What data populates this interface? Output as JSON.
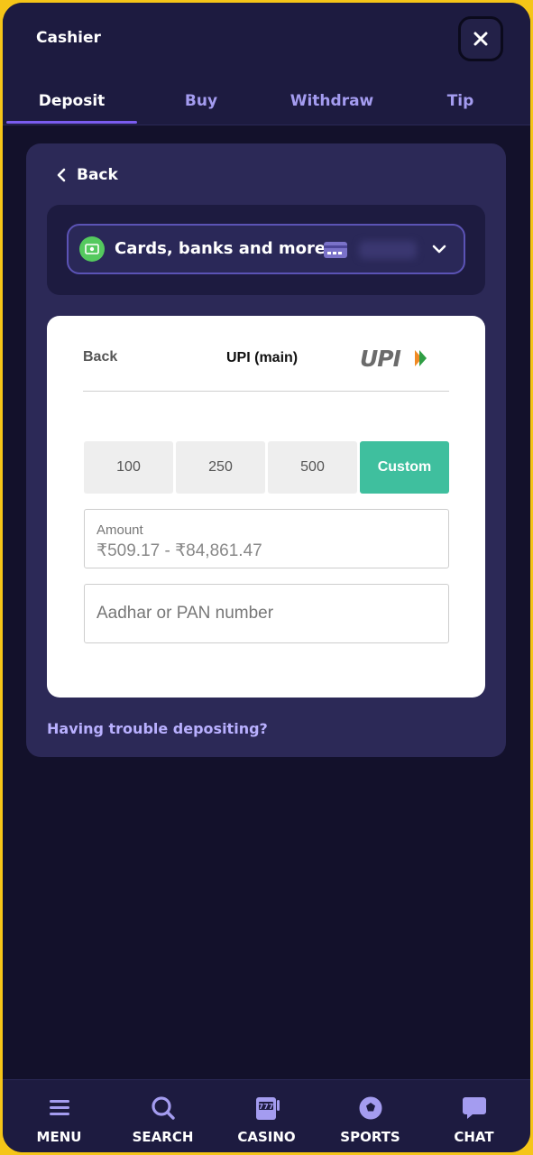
{
  "header": {
    "title": "Cashier",
    "close_icon": "close-icon"
  },
  "tabs": [
    {
      "label": "Deposit",
      "active": true
    },
    {
      "label": "Buy",
      "active": false
    },
    {
      "label": "Withdraw",
      "active": false
    },
    {
      "label": "Tip",
      "active": false
    }
  ],
  "panel": {
    "back_label": "Back",
    "method": {
      "label": "Cards, banks and more",
      "icon": "cash-icon",
      "card_icon": "credit-card-icon"
    },
    "upi_form": {
      "back_label": "Back",
      "title": "UPI (main)",
      "logo_text": "UPI",
      "amount_options": [
        "100",
        "250",
        "500",
        "Custom"
      ],
      "amount_label": "Amount",
      "amount_placeholder": "₹509.17 - ₹84,861.47",
      "id_placeholder": "Aadhar or PAN number"
    },
    "trouble_link": "Having trouble depositing?"
  },
  "bottom_nav": [
    {
      "label": "MENU",
      "icon": "menu-icon"
    },
    {
      "label": "SEARCH",
      "icon": "search-icon"
    },
    {
      "label": "CASINO",
      "icon": "slot-machine-icon"
    },
    {
      "label": "SPORTS",
      "icon": "soccer-ball-icon"
    },
    {
      "label": "CHAT",
      "icon": "chat-bubble-icon"
    }
  ],
  "colors": {
    "accent": "#7a5cf0",
    "custom_button": "#3fbf9e",
    "frame_border": "#f5c518",
    "background": "#13112b"
  }
}
